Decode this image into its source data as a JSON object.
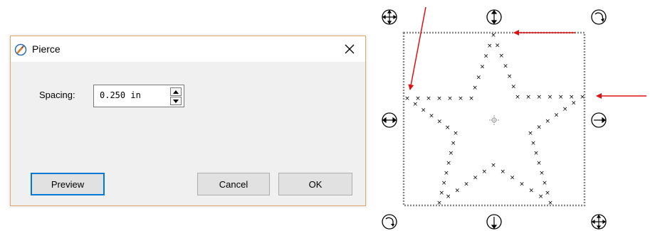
{
  "dialog": {
    "title": "Pierce",
    "spacing_label": "Spacing:",
    "spacing_value": "0.250 in",
    "buttons": {
      "preview": "Preview",
      "cancel": "Cancel",
      "ok": "OK"
    }
  },
  "colors": {
    "dialog_border": "#e0a968",
    "dialog_body": "#f0f0f0",
    "button_focus": "#0078d7",
    "annotation_arrow": "#dd1111"
  },
  "canvas": {
    "shape": "star",
    "pierce_mark": "×"
  }
}
